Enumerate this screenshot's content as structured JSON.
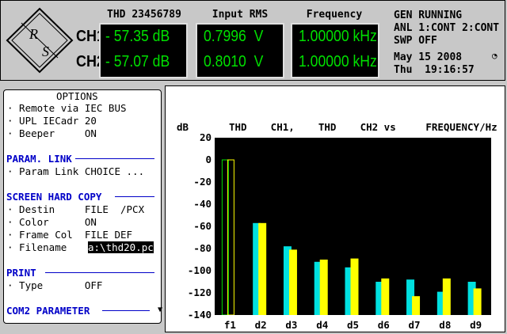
{
  "header": {
    "col_titles": [
      "THD 23456789",
      "Input RMS",
      "Frequency"
    ],
    "channels": [
      {
        "label": "CH1",
        "thd": "- 57.35 dB",
        "rms": "0.7996  V",
        "freq": "1.00000 kHz"
      },
      {
        "label": "CH2",
        "thd": "- 57.07 dB",
        "rms": "0.8010  V",
        "freq": "1.00000 kHz"
      }
    ],
    "status_line1": "GEN RUNNING",
    "status_line2": "ANL 1:CONT 2:CONT",
    "status_line3": "SWP OFF",
    "date": "May 15 2008",
    "time": "Thu  19:16:57",
    "logo_letters": "R S",
    "clock_icon": "clock-icon"
  },
  "options": {
    "title": "OPTIONS",
    "items_top": [
      "· Remote via IEC BUS",
      "· UPL IECadr 20",
      "· Beeper     ON"
    ],
    "section_param": "PARAM. LINK",
    "param_items": [
      "· Param Link CHOICE ..."
    ],
    "section_hardcopy": "SCREEN HARD COPY",
    "hardcopy_items": [
      "· Destin     FILE  /PCX",
      "· Color      ON",
      "· Frame Col  FILE DEF"
    ],
    "filename_label": "· Filename",
    "filename_value": "a:\\thd20.pc",
    "section_print": "PRINT",
    "print_items": [
      "· Type       OFF"
    ],
    "section_com2": "COM2 PARAMETER"
  },
  "graph": {
    "y_unit": "dB",
    "header_text": "THD    CH1,    THD    CH2 vs     FREQUENCY/Hz",
    "colors": {
      "ch1": "#00e0e0",
      "ch2": "#ffff00",
      "f1_alt": "#00e000",
      "plot_bg": "#000000"
    }
  },
  "chart_data": {
    "type": "bar",
    "title": "THD    CH1,    THD    CH2 vs     FREQUENCY/Hz",
    "ylabel": "dB",
    "xlabel": "",
    "ylim": [
      -140,
      20
    ],
    "yticks": [
      "20",
      "0",
      "-20",
      "-40",
      "-60",
      "-80",
      "-100",
      "-120",
      "-140"
    ],
    "categories": [
      "f1",
      "d2",
      "d3",
      "d4",
      "d5",
      "d6",
      "d7",
      "d8",
      "d9"
    ],
    "series": [
      {
        "name": "",
        "values": [
          0,
          -57,
          -78,
          -92,
          -97,
          -110,
          -108,
          -119,
          -110
        ]
      },
      {
        "name": "",
        "values": [
          0,
          -57,
          -81,
          -90,
          -89,
          -107,
          -123,
          -107,
          -116
        ]
      }
    ]
  }
}
